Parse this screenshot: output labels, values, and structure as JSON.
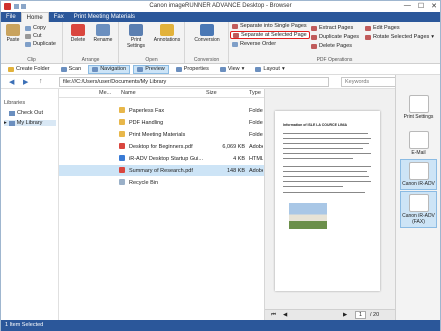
{
  "window": {
    "title": "Canon imageRUNNER ADVANCE Desktop - Browser",
    "controls": [
      "—",
      "☐",
      "✕"
    ]
  },
  "ribbon_tabs": [
    "File",
    "Home",
    "Fax",
    "Print Meeting Materials"
  ],
  "ribbon": {
    "clip": {
      "paste": "Paste",
      "copy": "Copy",
      "cut": "Cut",
      "duplicate": "Duplicate",
      "label": "Clip"
    },
    "arrange": {
      "delete": "Delete",
      "rename": "Rename",
      "label": "Arrange"
    },
    "open": {
      "print": "Print Settings",
      "annotations": "Annotations",
      "label": "Open"
    },
    "conversion": {
      "conversion": "Conversion",
      "label": "Conversion"
    },
    "pdf": {
      "separate_single": "Separate into Single Pages",
      "separate_selected": "Separate at Selected Page",
      "reverse": "Reverse Order",
      "extract": "Extract Pages",
      "duplicate": "Duplicate Pages",
      "delete": "Delete Pages",
      "edit": "Edit Pages",
      "rotate": "Rotate Selected Pages",
      "label": "PDF Operations"
    }
  },
  "navbar": {
    "create": "Create Folder",
    "scan": "Scan",
    "navigation": "Navigation",
    "preview": "Preview",
    "properties": "Properties",
    "view": "View",
    "layout": "Layout"
  },
  "address": {
    "path": "file:///C:/Users/user/Documents/My Library",
    "search_placeholder": "Keywords"
  },
  "left": {
    "header": "Libraries",
    "items": [
      "Check Out",
      "My Library"
    ]
  },
  "columns": {
    "me": "Me...",
    "name": "Name",
    "size": "Size",
    "type": "Type"
  },
  "files": [
    {
      "name": "Paperless Fax",
      "size": "",
      "type": "Folder"
    },
    {
      "name": "PDF Handling",
      "size": "",
      "type": "Folder"
    },
    {
      "name": "Print Meeting Materials",
      "size": "",
      "type": "Folder"
    },
    {
      "name": "Desktop for Beginners.pdf",
      "size": "6,069 KB",
      "type": "Adobe"
    },
    {
      "name": "iR-ADV Desktop Startup Gui...",
      "size": "4 KB",
      "type": "HTML"
    },
    {
      "name": "Summary of Research.pdf",
      "size": "148 KB",
      "type": "Adobe"
    },
    {
      "name": "Recycle Bin",
      "size": "",
      "type": ""
    }
  ],
  "preview": {
    "doc_title": "Information of ISLE LA COURCE LINIA",
    "page": "1",
    "total": "/ 20"
  },
  "right_tools": [
    "Print Settings",
    "E-Mail",
    "Canon iR-ADV",
    "Canon iR-ADV (FAX)"
  ],
  "status": "1 Item Selected",
  "colors": {
    "accent": "#2b579a",
    "highlight": "#e02020",
    "selection": "#cde4f6"
  }
}
